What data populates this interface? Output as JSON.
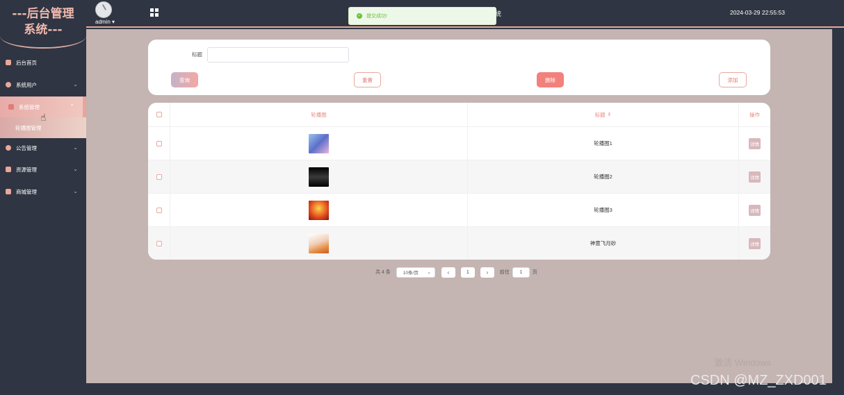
{
  "app": {
    "logo_line1": "---后台管理",
    "logo_line2": "系统---",
    "user": "admin",
    "datetime": "2024-03-29 22:55:53",
    "title_tail": "统",
    "toast": "提交成功!"
  },
  "sidebar": {
    "items": [
      {
        "label": "后台首页",
        "icon": "monitor-icon"
      },
      {
        "label": "系统用户",
        "icon": "user-icon"
      },
      {
        "label": "系统管理",
        "icon": "chart-icon"
      },
      {
        "label": "公告管理",
        "icon": "info-icon"
      },
      {
        "label": "资源管理",
        "icon": "flag-icon"
      },
      {
        "label": "商城管理",
        "icon": "shop-icon"
      }
    ],
    "submenu_label": "轮播图管理"
  },
  "search": {
    "label": "标题",
    "value": "",
    "query_btn": "查询",
    "reset_btn": "重置",
    "delete_btn": "删除",
    "add_btn": "添加"
  },
  "table": {
    "columns": [
      "轮播图",
      "标题",
      "操作"
    ],
    "rows": [
      {
        "title": "轮播图1",
        "action": "详情",
        "thumb_color": "#6fa0d8"
      },
      {
        "title": "轮播图2",
        "action": "详情",
        "thumb_color": "#111111"
      },
      {
        "title": "轮播图3",
        "action": "详情",
        "thumb_color": "#e04a1f"
      },
      {
        "title": "神意飞月砂",
        "action": "详情",
        "thumb_color": "#e8c4a8"
      }
    ]
  },
  "pagination": {
    "total": "共 4 条",
    "page_size": "10条/页",
    "current": "1",
    "goto_label": "前往",
    "goto_value": "1",
    "page_unit": "页"
  },
  "watermarks": {
    "windows": "激活 Windows",
    "csdn": "CSDN @MZ_ZXD001"
  },
  "colors": {
    "accent": "#e9a79a",
    "main_bg": "#c4b4b2",
    "sidebar_bg": "#2f3542"
  }
}
